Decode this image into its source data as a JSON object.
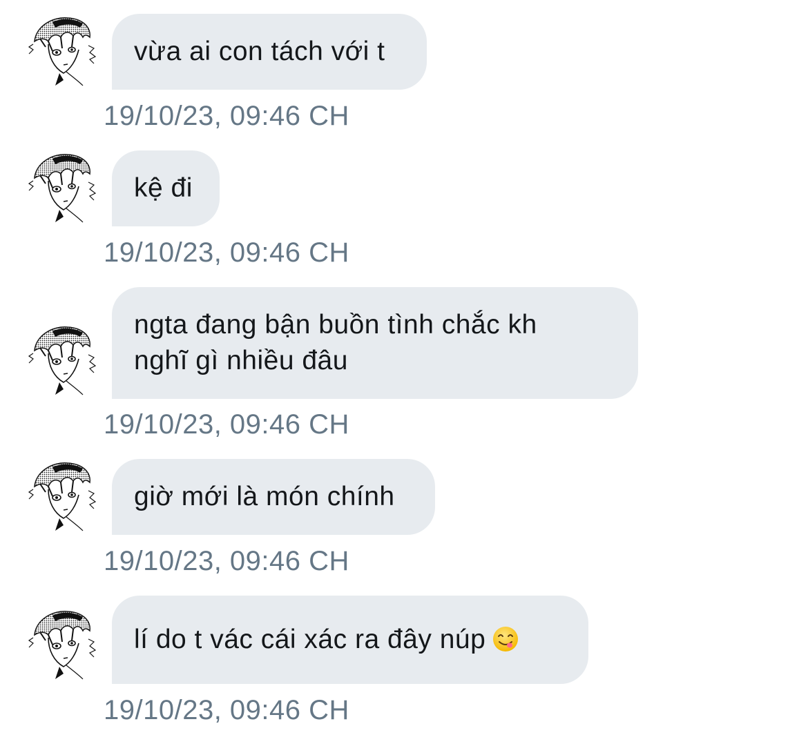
{
  "conversation": {
    "messages": [
      {
        "text": "vừa ai con tách với t",
        "timestamp": "19/10/23, 09:46 CH"
      },
      {
        "text": "kệ đi",
        "timestamp": "19/10/23, 09:46 CH"
      },
      {
        "text_line1": "ngta đang bận buồn tình chắc kh",
        "text_line2": "nghĩ gì nhiều đâu",
        "timestamp": "19/10/23, 09:46 CH"
      },
      {
        "text": "giờ mới là món chính",
        "timestamp": "19/10/23, 09:46 CH"
      },
      {
        "text": "lí do t vác cái xác ra đây núp",
        "emoji": "savoring-food-face-emoji",
        "timestamp": "19/10/23, 09:46 CH"
      }
    ]
  },
  "colors": {
    "bubble_bg": "#e7ebef",
    "text": "#14171a",
    "timestamp": "#657786"
  }
}
